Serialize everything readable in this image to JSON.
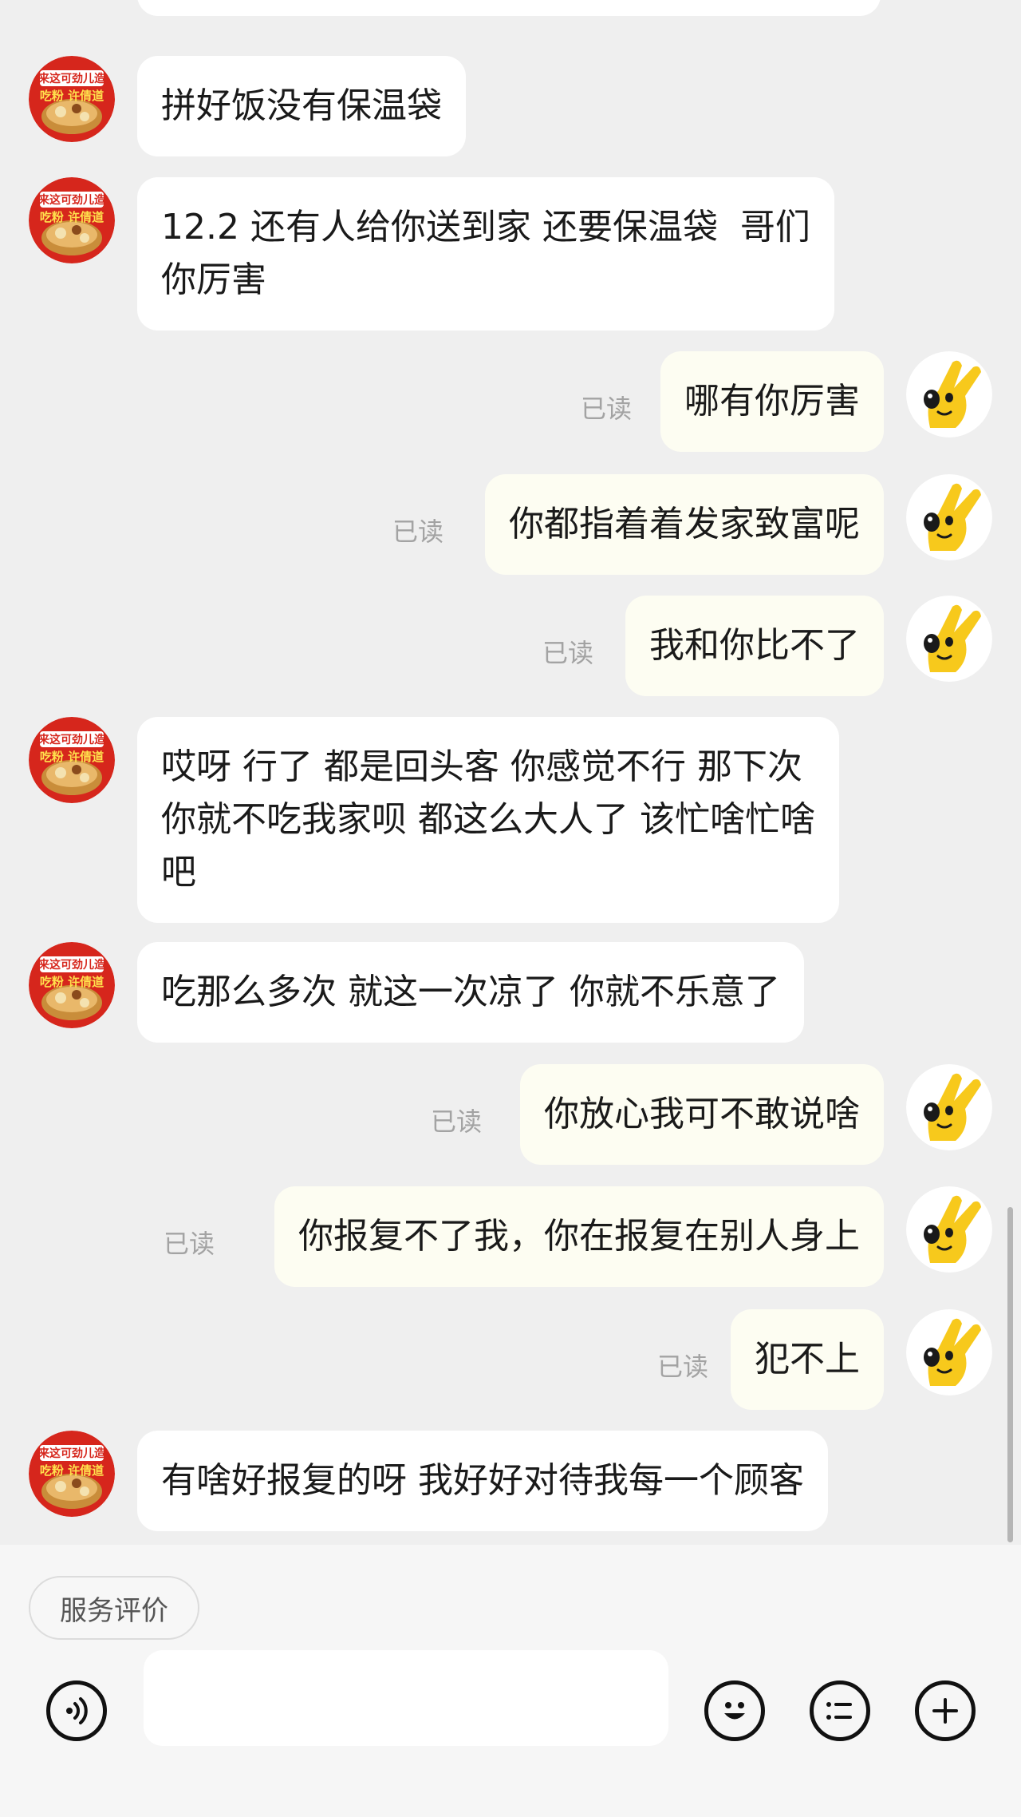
{
  "colors": {
    "background": "#efefef",
    "incoming_bubble": "#ffffff",
    "outgoing_bubble": "#fdfdf2",
    "read_text": "#a3a3a3",
    "shop_avatar_red": "#d6261c",
    "user_avatar_yellow": "#f7c91c"
  },
  "avatars": {
    "shop": {
      "icon": "shop-logo-avatar",
      "text_line1": "来这可劲儿造",
      "text_line2": "吃粉 许倩道"
    },
    "user": {
      "icon": "yellow-hand-mascot-avatar"
    }
  },
  "messages": [
    {
      "side": "in",
      "text": "拼好饭没有保温袋"
    },
    {
      "side": "in",
      "text": "12.2 还有人给你送到家 还要保温袋  哥们\n你厉害"
    },
    {
      "side": "out",
      "text": "哪有你厉害",
      "status": "已读"
    },
    {
      "side": "out",
      "text": "你都指着着发家致富呢",
      "status": "已读"
    },
    {
      "side": "out",
      "text": "我和你比不了",
      "status": "已读"
    },
    {
      "side": "in",
      "text": "哎呀 行了 都是回头客 你感觉不行 那下次\n你就不吃我家呗 都这么大人了 该忙啥忙啥\n吧"
    },
    {
      "side": "in",
      "text": "吃那么多次 就这一次凉了 你就不乐意了"
    },
    {
      "side": "out",
      "text": "你放心我可不敢说啥",
      "status": "已读"
    },
    {
      "side": "out",
      "text": "你报复不了我，你在报复在别人身上",
      "status": "已读"
    },
    {
      "side": "out",
      "text": "犯不上",
      "status": "已读"
    },
    {
      "side": "in",
      "text": "有啥好报复的呀 我好好对待我每一个顾客"
    }
  ],
  "footer": {
    "rating_chip": "服务评价",
    "input": {
      "value": "",
      "placeholder": ""
    },
    "icons": [
      "voice-icon",
      "emoji-icon",
      "quick-reply-list-icon",
      "plus-icon"
    ]
  }
}
